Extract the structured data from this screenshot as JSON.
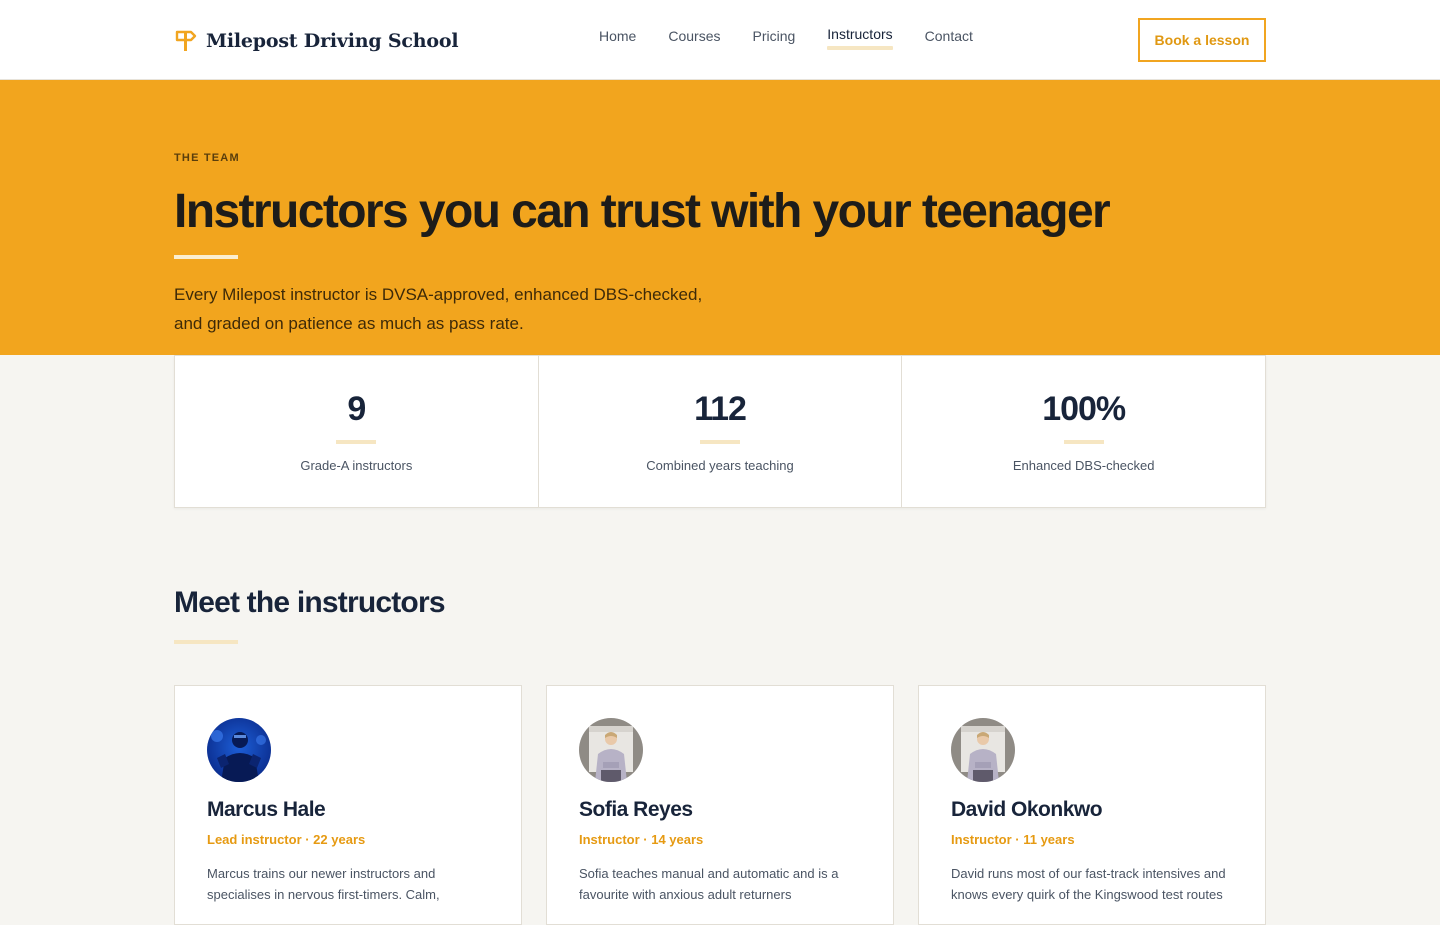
{
  "header": {
    "brand": "Milepost Driving School",
    "nav": [
      "Home",
      "Courses",
      "Pricing",
      "Instructors",
      "Contact"
    ],
    "active_nav": "Instructors",
    "cta": "Book a lesson"
  },
  "hero": {
    "eyebrow": "THE TEAM",
    "title": "Instructors you can trust with your teenager",
    "subtitle_line1": "Every Milepost instructor is DVSA-approved, enhanced DBS-checked,",
    "subtitle_line2": "and graded on patience as much as pass rate."
  },
  "stats": [
    {
      "value": "9",
      "label": "Grade-A instructors"
    },
    {
      "value": "112",
      "label": "Combined years teaching"
    },
    {
      "value": "100%",
      "label": "Enhanced DBS-checked"
    }
  ],
  "section": {
    "title": "Meet the instructors"
  },
  "instructors": [
    {
      "name": "Marcus Hale",
      "role": "Lead instructor · 22 years",
      "bio_line1": "Marcus trains our newer instructors and",
      "bio_line2": "specialises in nervous first-timers. Calm,"
    },
    {
      "name": "Sofia Reyes",
      "role": "Instructor · 14 years",
      "bio_line1": "Sofia teaches manual and automatic and is a",
      "bio_line2": "favourite with anxious adult returners"
    },
    {
      "name": "David Okonkwo",
      "role": "Instructor · 11 years",
      "bio_line1": "David runs most of our fast-track intensives and",
      "bio_line2": "knows every quirk of the Kingswood test routes"
    }
  ],
  "colors": {
    "accent": "#f2a51e",
    "navy": "#18243a",
    "background": "#f6f5f1"
  }
}
